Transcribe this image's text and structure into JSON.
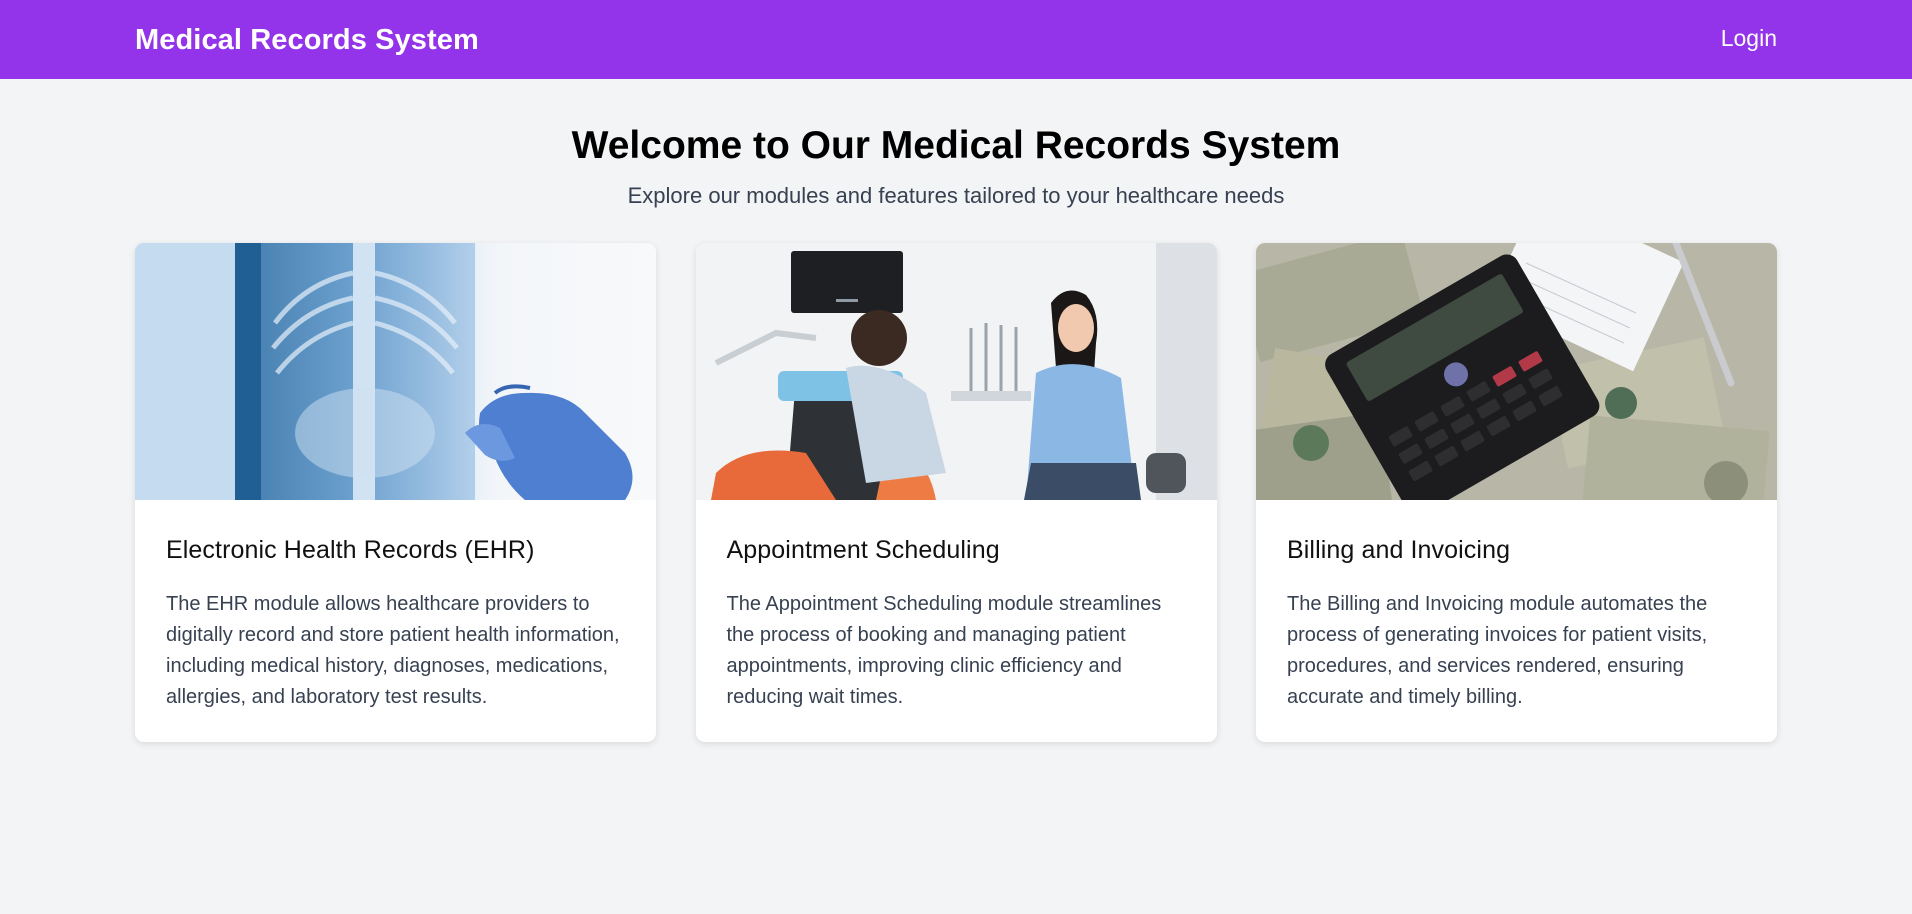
{
  "header": {
    "brand": "Medical Records System",
    "login_label": "Login",
    "accent_color": "#9333ea"
  },
  "hero": {
    "title": "Welcome to Our Medical Records System",
    "subtitle": "Explore our modules and features tailored to your healthcare needs"
  },
  "cards": [
    {
      "image": "xray-photo",
      "title": "Electronic Health Records (EHR)",
      "description": "The EHR module allows healthcare providers to digitally record and store patient health information, including medical history, diagnoses, medications, allergies, and laboratory test results."
    },
    {
      "image": "dental-clinic-photo",
      "title": "Appointment Scheduling",
      "description": "The Appointment Scheduling module streamlines the process of booking and managing patient appointments, improving clinic efficiency and reducing wait times."
    },
    {
      "image": "calculator-money-photo",
      "title": "Billing and Invoicing",
      "description": "The Billing and Invoicing module automates the process of generating invoices for patient visits, procedures, and services rendered, ensuring accurate and timely billing."
    }
  ]
}
